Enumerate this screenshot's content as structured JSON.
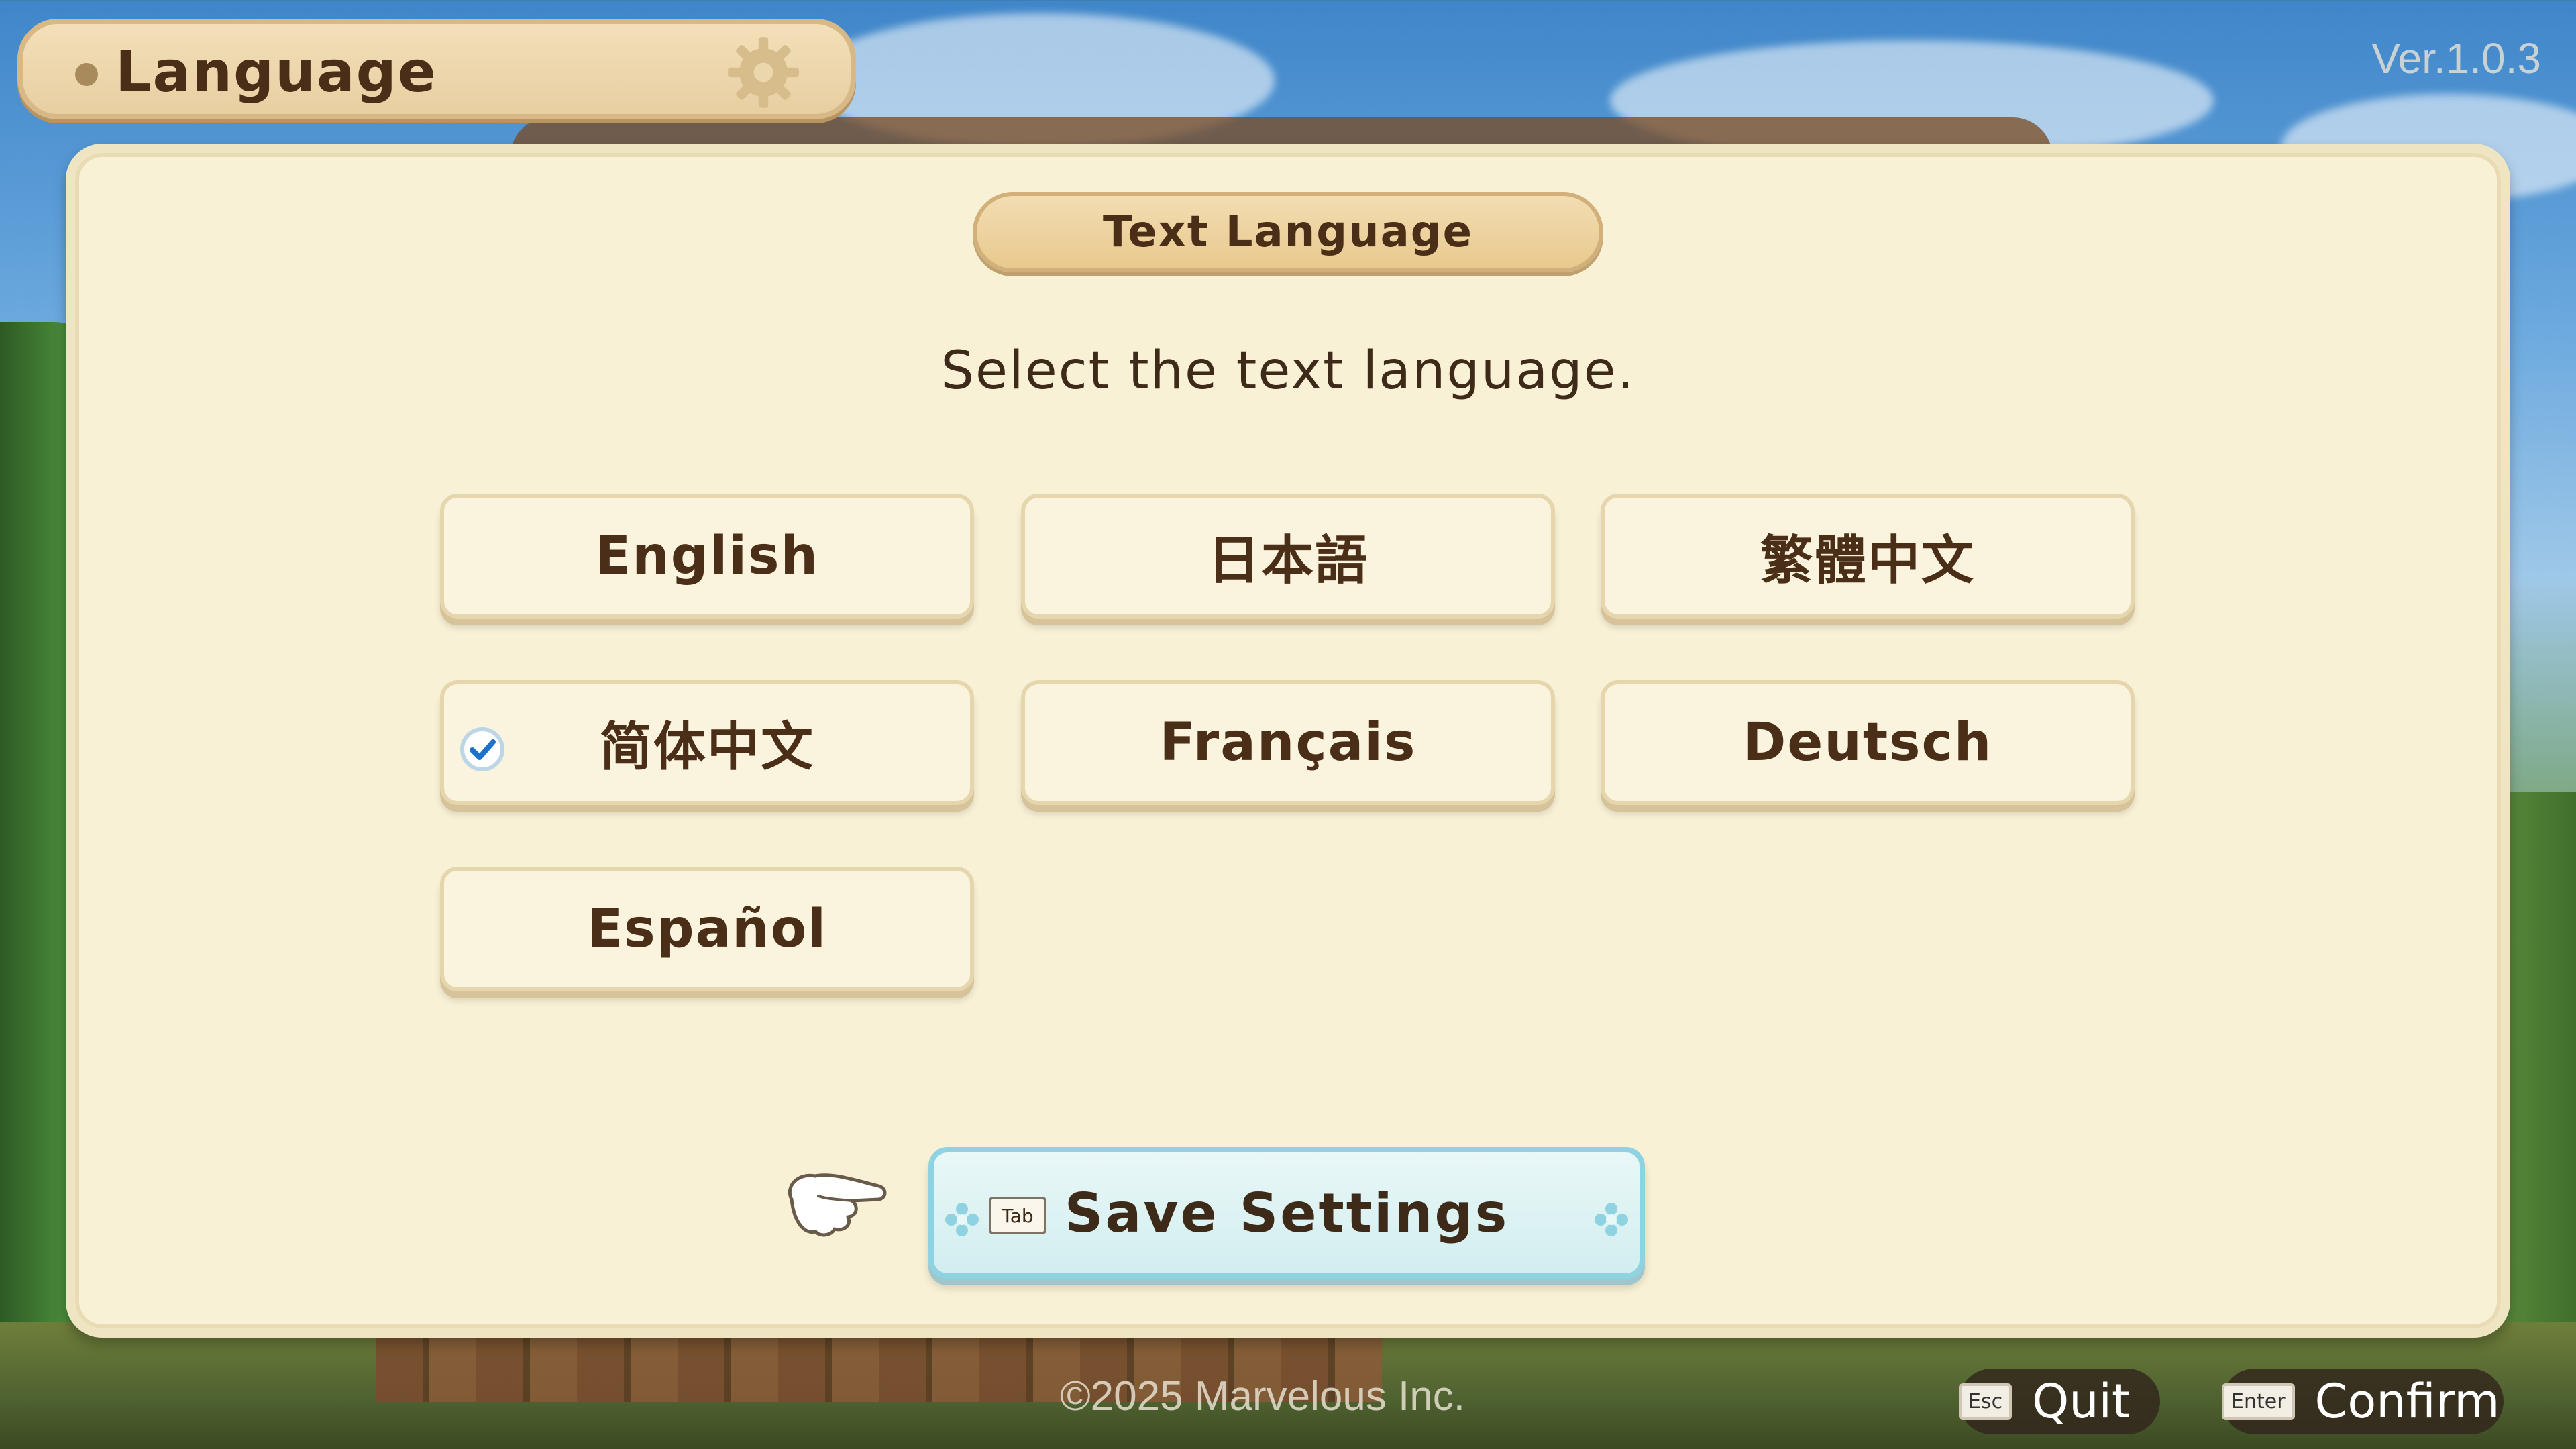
{
  "header": {
    "title": "Language"
  },
  "version": "Ver.1.0.3",
  "panel": {
    "section_title": "Text Language",
    "instruction": "Select the text language."
  },
  "languages": [
    {
      "label": "English",
      "selected": false
    },
    {
      "label": "日本語",
      "selected": false
    },
    {
      "label": "繁體中文",
      "selected": false
    },
    {
      "label": "简体中文",
      "selected": true
    },
    {
      "label": "Français",
      "selected": false
    },
    {
      "label": "Deutsch",
      "selected": false
    },
    {
      "label": "Español",
      "selected": false
    }
  ],
  "save": {
    "key": "Tab",
    "label": "Save Settings"
  },
  "footer": {
    "copyright": "©2025 Marvelous Inc.",
    "quit": {
      "key": "Esc",
      "label": "Quit"
    },
    "confirm": {
      "key": "Enter",
      "label": "Confirm"
    }
  },
  "colors": {
    "panel_bg": "#f8f1d6",
    "text_brown": "#4a2e17",
    "save_border": "#8fd3e2",
    "check_blue": "#1e73c8"
  }
}
